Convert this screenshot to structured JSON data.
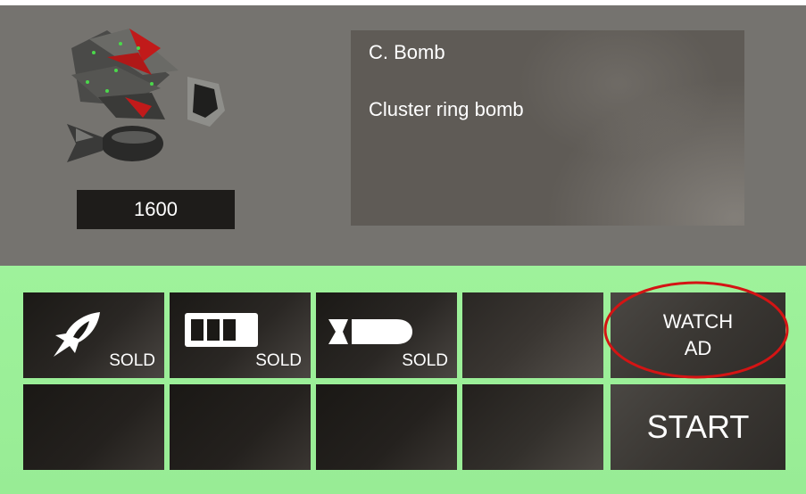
{
  "item": {
    "name": "C. Bomb",
    "description": "Cluster ring bomb",
    "price": "1600"
  },
  "shop_slots": [
    {
      "icon": "rocket-flame-icon",
      "status": "SOLD"
    },
    {
      "icon": "battery-icon",
      "status": "SOLD"
    },
    {
      "icon": "bomb-icon",
      "status": "SOLD"
    },
    {
      "icon": "",
      "status": ""
    }
  ],
  "buttons": {
    "watch_ad": "WATCH\nAD",
    "start": "START"
  },
  "colors": {
    "top_panel": "#75736f",
    "bottom_panel": "#9ef29b",
    "slot_dark": "#1b1916",
    "highlight_circle": "#d41414"
  }
}
